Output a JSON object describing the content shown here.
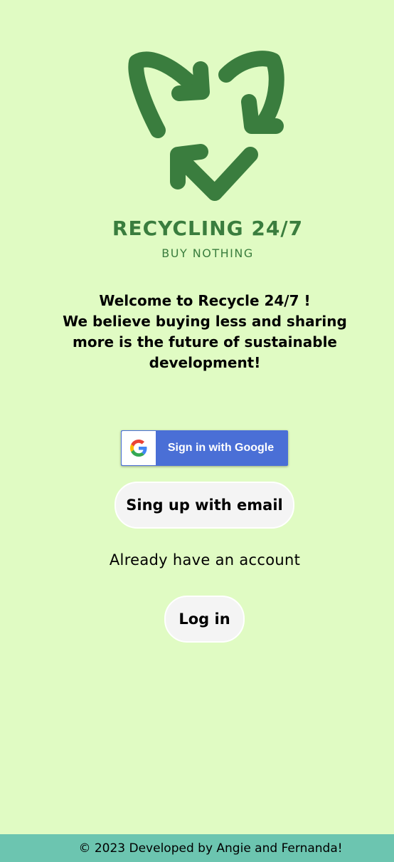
{
  "brand": {
    "title": "RECYCLING 24/7",
    "subtitle": "BUY NOTHING",
    "logo_icon": "recycle-arrows-icon",
    "color": "#3a7d3e"
  },
  "welcome": {
    "line1": "Welcome to Recycle 24/7 !",
    "line2": "We believe buying less and sharing",
    "line3": "more is the future of sustainable",
    "line4": "development!"
  },
  "auth": {
    "google_label": "Sign in with Google",
    "google_icon": "google-g-icon",
    "signup_label": "Sing up with email",
    "already_text": "Already have an account",
    "login_label": "Log in"
  },
  "footer": {
    "text": "© 2023 Developed by Angie and Fernanda!"
  },
  "colors": {
    "background": "#e0fbc3",
    "footer": "#6cc5b0",
    "google_blue": "#4a6fd6",
    "button_bg": "#f4f4f4"
  }
}
